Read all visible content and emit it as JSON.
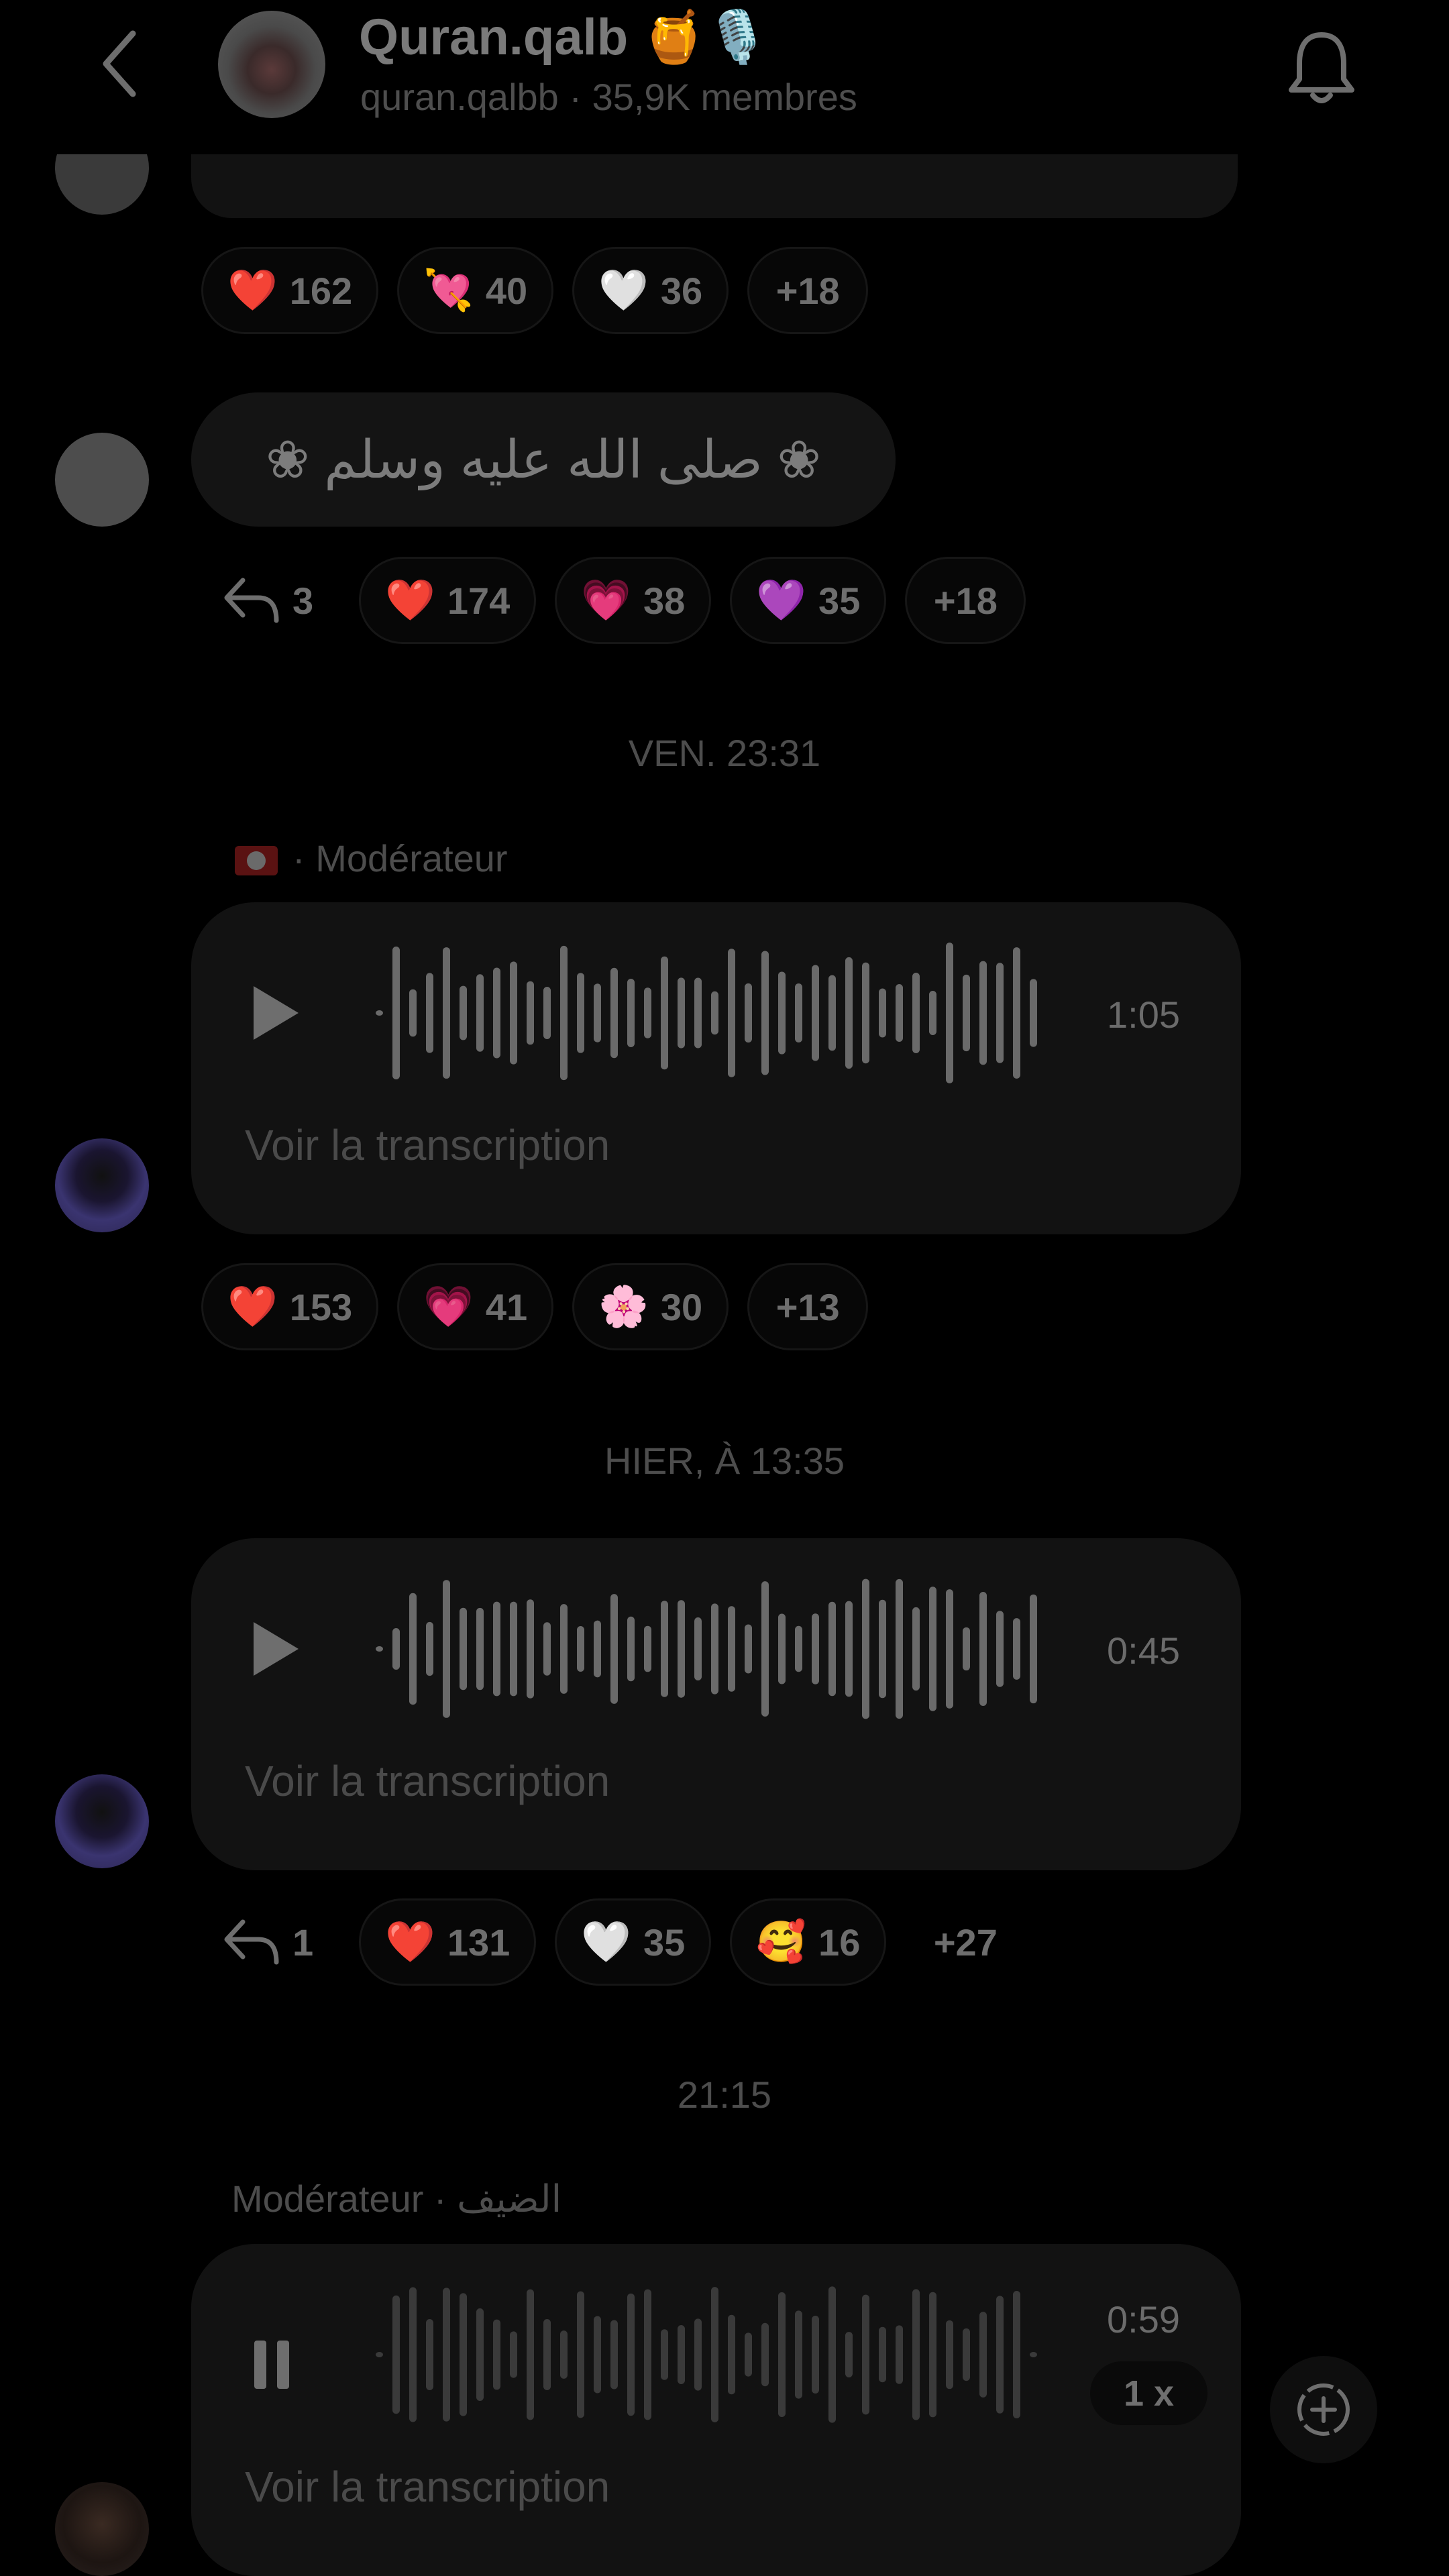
{
  "header": {
    "title": "Quran.qalb 🍯🎙️",
    "subtitle": "quran.qalbb · 35,9K membres"
  },
  "messages": [
    {
      "reactions": [
        {
          "emoji": "❤️",
          "count": "162"
        },
        {
          "emoji": "💘",
          "count": "40"
        },
        {
          "emoji": "🤍",
          "count": "36"
        }
      ],
      "more": "+18"
    },
    {
      "text": "❀ صلى الله عليه وسلم ❀",
      "replies": "3",
      "reactions": [
        {
          "emoji": "❤️",
          "count": "174"
        },
        {
          "emoji": "💗",
          "count": "38"
        },
        {
          "emoji": "💜",
          "count": "35"
        }
      ],
      "more": "+18"
    },
    {
      "timestamp": "VEN. 23:31",
      "sender_role": "· Modérateur",
      "duration": "1:05",
      "transcript_label": "Voir la transcription",
      "reactions": [
        {
          "emoji": "❤️",
          "count": "153"
        },
        {
          "emoji": "💗",
          "count": "41"
        },
        {
          "emoji": "🌸",
          "count": "30"
        }
      ],
      "more": "+13"
    },
    {
      "timestamp": "HIER, À 13:35",
      "duration": "0:45",
      "transcript_label": "Voir la transcription",
      "replies": "1",
      "reactions": [
        {
          "emoji": "❤️",
          "count": "131"
        },
        {
          "emoji": "🤍",
          "count": "35"
        },
        {
          "emoji": "🥰",
          "count": "16"
        }
      ],
      "more": "+27"
    },
    {
      "timestamp": "21:15",
      "sender_role": "Modérateur · الضيف",
      "duration": "0:59",
      "speed": "1 x",
      "transcript_label": "Voir la transcription"
    }
  ],
  "icons": {
    "back": "chevron-left-icon",
    "bell": "bell-icon",
    "play": "play-icon",
    "pause": "pause-icon",
    "reply": "reply-icon",
    "add": "add-reaction-icon"
  },
  "colors": {
    "background": "#000000",
    "bubble": "#131313",
    "text": "#6e6e6e"
  }
}
